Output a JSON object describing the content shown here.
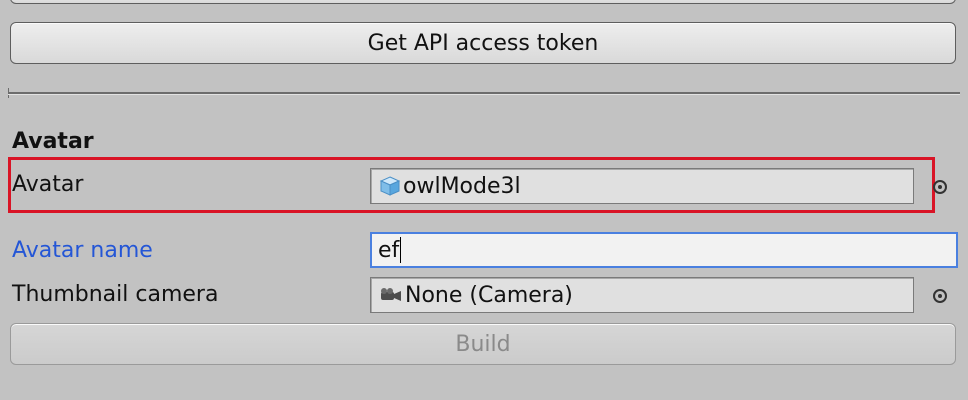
{
  "toolbar": {
    "get_api_token_label": "Get API access token",
    "build_label": "Build"
  },
  "avatar_section": {
    "title": "Avatar",
    "avatar_field": {
      "label": "Avatar",
      "value": "owlMode3l",
      "icon": "cube-icon"
    },
    "avatar_name": {
      "label": "Avatar name",
      "value": "ef"
    },
    "thumbnail_camera": {
      "label": "Thumbnail camera",
      "value": "None (Camera)",
      "icon": "camera-icon"
    }
  },
  "colors": {
    "highlight": "#d91426",
    "focus_label": "#2456d6",
    "focus_border": "#4a80e0"
  }
}
